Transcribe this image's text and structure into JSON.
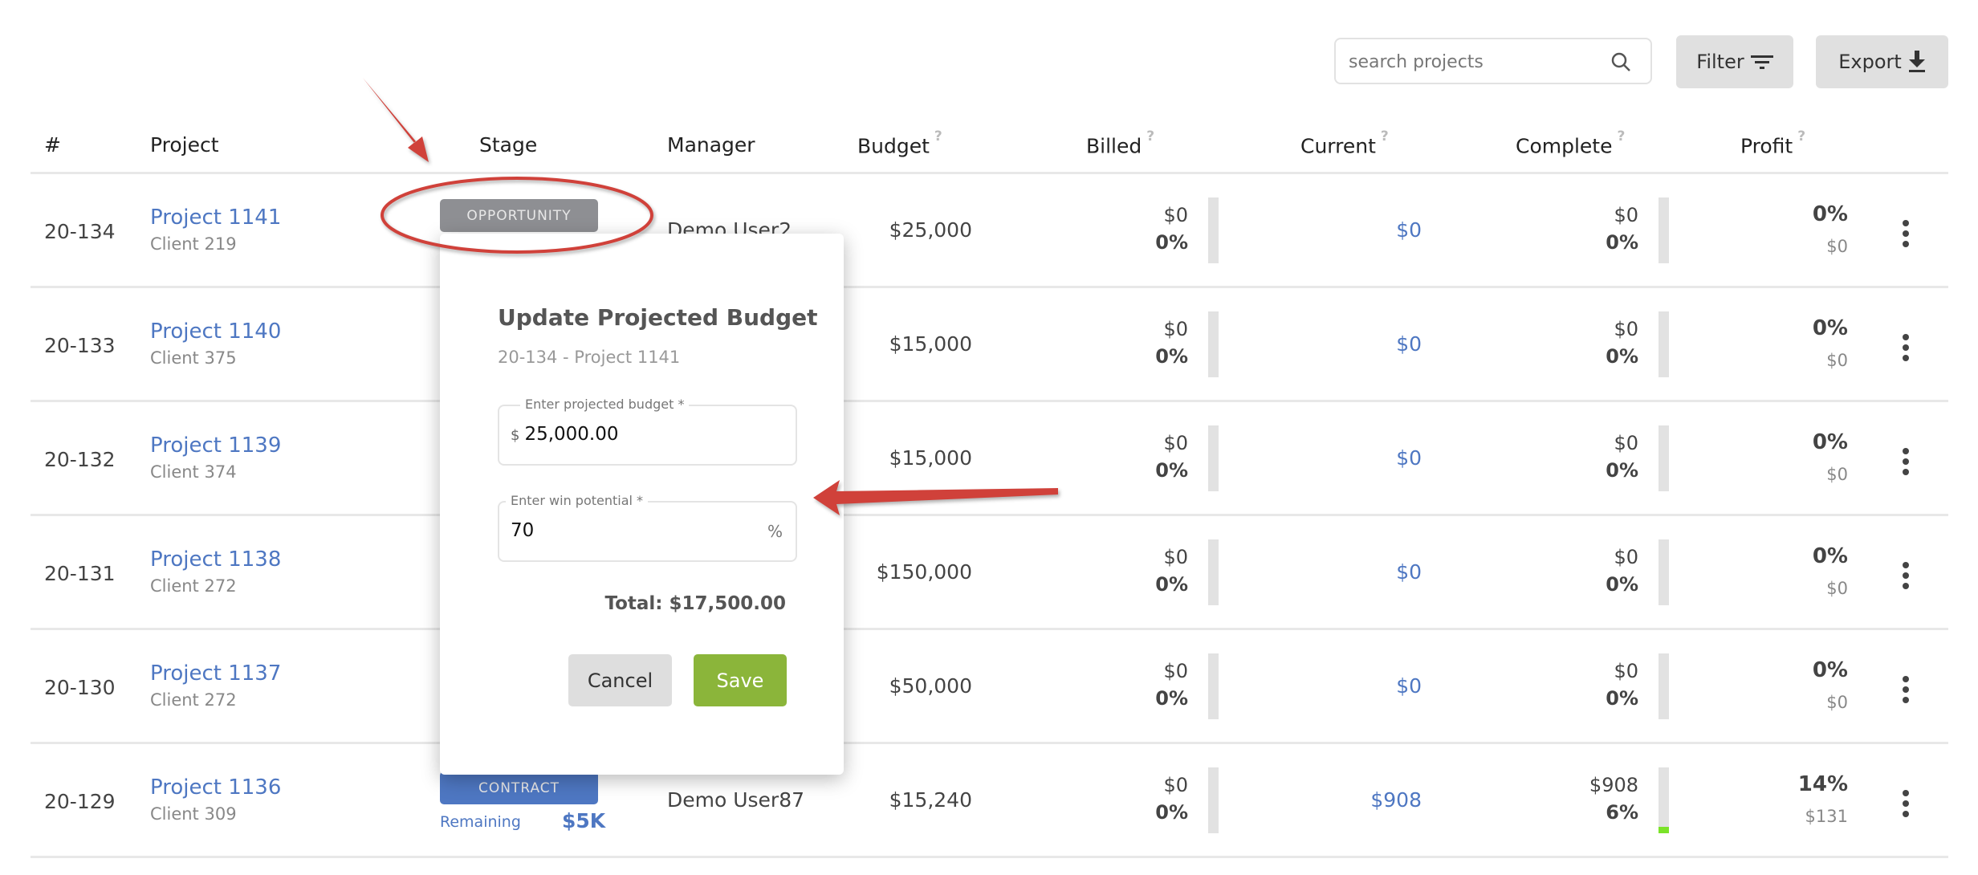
{
  "toolbar": {
    "search_placeholder": "search projects",
    "search_icon": "search-icon",
    "filter_label": "Filter",
    "filter_icon": "filter-icon",
    "export_label": "Export",
    "export_icon": "download-icon"
  },
  "table": {
    "headers": {
      "num": "#",
      "project": "Project",
      "stage": "Stage",
      "manager": "Manager",
      "budget": "Budget",
      "billed": "Billed",
      "current": "Current",
      "complete": "Complete",
      "profit": "Profit",
      "help": "?"
    },
    "rows": [
      {
        "num": "20-134",
        "project": "Project 1141",
        "client": "Client 219",
        "stage": "OPPORTUNITY",
        "manager": "Demo User2",
        "budget": "$25,000",
        "billed": "$0",
        "billed_pct": "0%",
        "current": "$0",
        "complete": "$0",
        "complete_pct": "0%",
        "complete_fill": 0,
        "profit_pct": "0%",
        "profit": "$0"
      },
      {
        "num": "20-133",
        "project": "Project 1140",
        "client": "Client 375",
        "budget": "$15,000",
        "billed": "$0",
        "billed_pct": "0%",
        "current": "$0",
        "complete": "$0",
        "complete_pct": "0%",
        "complete_fill": 0,
        "profit_pct": "0%",
        "profit": "$0"
      },
      {
        "num": "20-132",
        "project": "Project 1139",
        "client": "Client 374",
        "budget": "$15,000",
        "billed": "$0",
        "billed_pct": "0%",
        "current": "$0",
        "complete": "$0",
        "complete_pct": "0%",
        "complete_fill": 0,
        "profit_pct": "0%",
        "profit": "$0"
      },
      {
        "num": "20-131",
        "project": "Project 1138",
        "client": "Client 272",
        "budget": "$150,000",
        "billed": "$0",
        "billed_pct": "0%",
        "current": "$0",
        "complete": "$0",
        "complete_pct": "0%",
        "complete_fill": 0,
        "profit_pct": "0%",
        "profit": "$0"
      },
      {
        "num": "20-130",
        "project": "Project 1137",
        "client": "Client 272",
        "budget": "$50,000",
        "billed": "$0",
        "billed_pct": "0%",
        "current": "$0",
        "complete": "$0",
        "complete_pct": "0%",
        "complete_fill": 0,
        "profit_pct": "0%",
        "profit": "$0"
      },
      {
        "num": "20-129",
        "project": "Project 1136",
        "client": "Client 309",
        "stage": "CONTRACT",
        "remaining_label": "Remaining",
        "remaining": "$5K",
        "manager": "Demo User87",
        "budget": "$15,240",
        "billed": "$0",
        "billed_pct": "0%",
        "current": "$908",
        "complete": "$908",
        "complete_pct": "6%",
        "complete_fill": 6,
        "profit_pct": "14%",
        "profit": "$131"
      }
    ]
  },
  "dialog": {
    "title": "Update Projected Budget",
    "subtitle": "20-134 - Project 1141",
    "budget_label": "Enter projected budget *",
    "budget_prefix": "$",
    "budget_value": "25,000.00",
    "win_label": "Enter win potential *",
    "win_value": "70",
    "win_suffix": "%",
    "total": "Total: $17,500.00",
    "cancel_label": "Cancel",
    "save_label": "Save"
  },
  "colors": {
    "accent_blue": "#4e77c2",
    "save_green": "#8bb53a",
    "opportunity_grey": "#8e8f93",
    "contract_blue": "#4e77c2",
    "annotation_red": "#d0413a",
    "progress_green": "#7be329"
  }
}
